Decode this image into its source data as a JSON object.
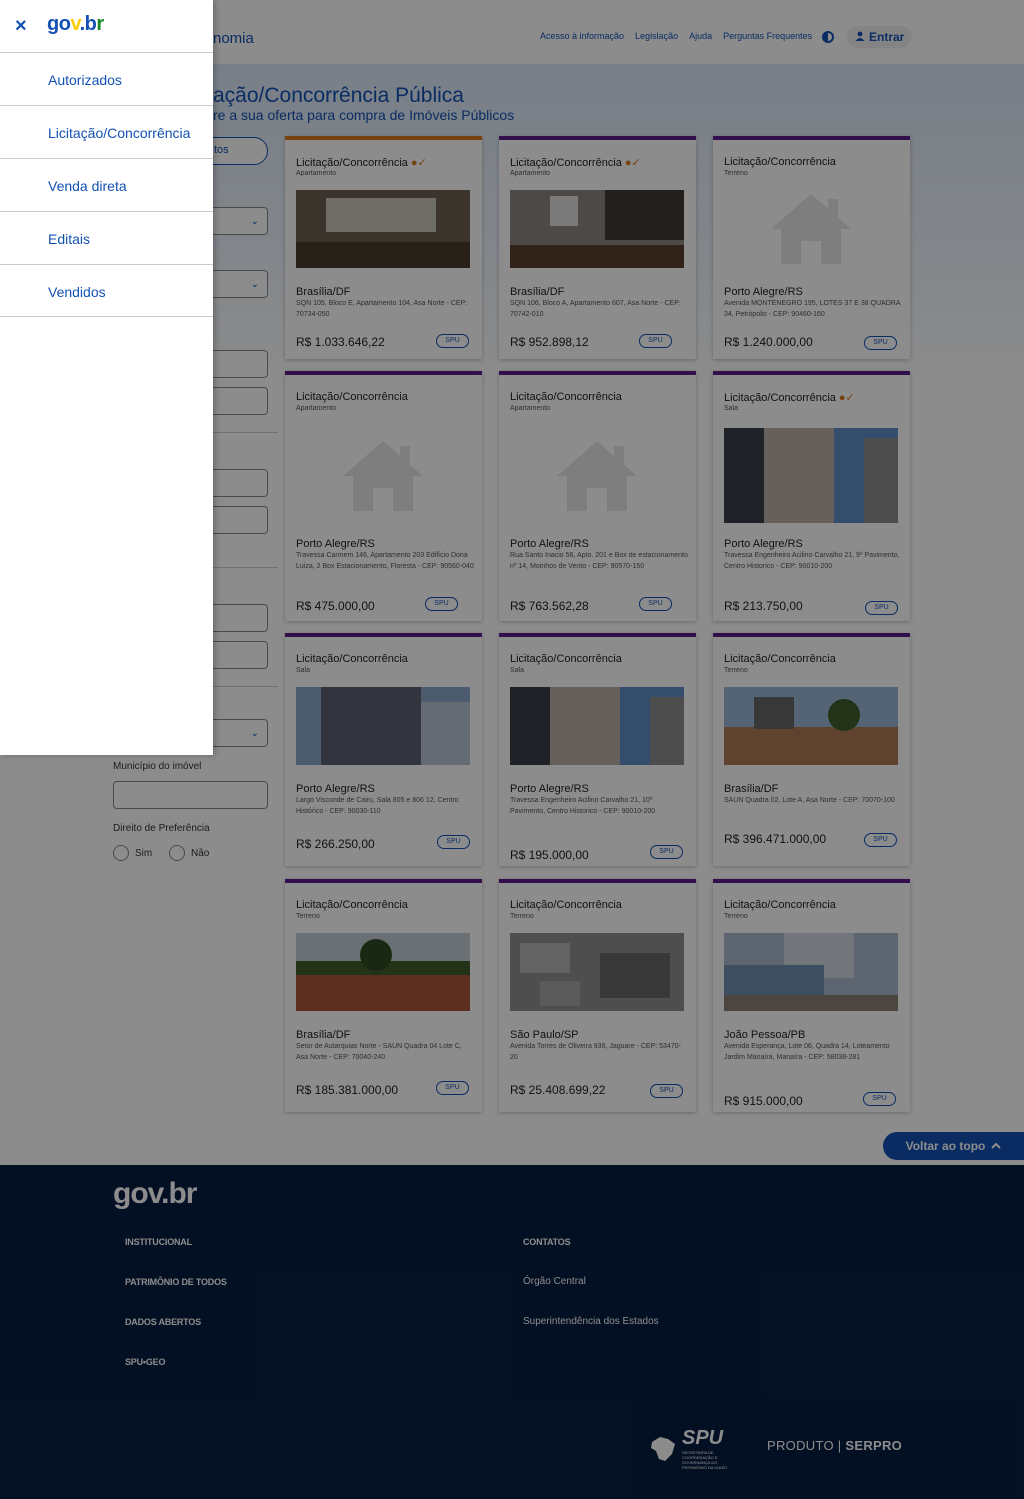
{
  "header": {
    "app_title": "nomia",
    "links": [
      "Acesso à informação",
      "Legislação",
      "Ajuda",
      "Perguntas Frequentes"
    ],
    "login_label": "Entrar"
  },
  "page": {
    "title": "ação/Concorrência Pública",
    "subtitle": "re a sua oferta para compra de Imóveis Públicos",
    "filter_button": "tos"
  },
  "filters": {
    "municipio_label": "Município do imóvel",
    "preferencia_label": "Direito de Preferência",
    "opt_sim": "Sim",
    "opt_nao": "Não"
  },
  "cards": [
    {
      "title": "Licitação/Concorrência",
      "type": "Apartamento",
      "city": "Brasília/DF",
      "address": "SQN 105, Bloco E, Apartamento 104, Asa Norte - CEP: 70734-050",
      "price": "R$ 1.033.646,22",
      "badge": "SPU",
      "authorized": true,
      "image": "room"
    },
    {
      "title": "Licitação/Concorrência",
      "type": "Apartamento",
      "city": "Brasília/DF",
      "address": "SQN 106, Bloco A, Apartamento 607, Asa Norte - CEP: 70742-010",
      "price": "R$ 952.898,12",
      "badge": "SPU",
      "authorized": true,
      "image": "room2"
    },
    {
      "title": "Licitação/Concorrência",
      "type": "Terreno",
      "city": "Porto Alegre/RS",
      "address": "Avenida MONTENEGRO 195, LOTES 37 E 38 QUADRA 34, Petrópolis - CEP: 90460-160",
      "price": "R$ 1.240.000,00",
      "badge": "SPU",
      "authorized": false,
      "image": "placeholder"
    },
    {
      "title": "Licitação/Concorrência",
      "type": "Apartamento",
      "city": "Porto Alegre/RS",
      "address": "Travessa Carmem 146, Apartamento 203 Edifício Dona Luiza, 2 Box Estacionamento, Floresta - CEP: 90560-040",
      "price": "R$ 475.000,00",
      "badge": "SPU",
      "authorized": false,
      "image": "placeholder"
    },
    {
      "title": "Licitação/Concorrência",
      "type": "Apartamento",
      "city": "Porto Alegre/RS",
      "address": "Rua Santo Inacio 56, Apto. 201 e Box de estacionamento nº 14, Moinhos de Vento - CEP: 90570-150",
      "price": "R$ 763.562,28",
      "badge": "SPU",
      "authorized": false,
      "image": "placeholder"
    },
    {
      "title": "Licitação/Concorrência",
      "type": "Sala",
      "city": "Porto Alegre/RS",
      "address": "Travessa Engenheiro Acilino Carvalho 21, 9º Pavimento, Centro Historico - CEP: 90010-200",
      "price": "R$ 213.750,00",
      "badge": "SPU",
      "authorized": true,
      "image": "building"
    },
    {
      "title": "Licitação/Concorrência",
      "type": "Sala",
      "city": "Porto Alegre/RS",
      "address": "Largo Visconde de Cairu, Sala 805 e 806 12, Centro Histórico - CEP: 90030-110",
      "price": "R$ 266.250,00",
      "badge": "SPU",
      "authorized": false,
      "image": "tower"
    },
    {
      "title": "Licitação/Concorrência",
      "type": "Sala",
      "city": "Porto Alegre/RS",
      "address": "Travessa Engenheiro Acilino Carvalho 21, 10º Pavimento, Centro Historico - CEP: 90010-200",
      "price": "R$ 195.000,00",
      "badge": "SPU",
      "authorized": false,
      "image": "building"
    },
    {
      "title": "Licitação/Concorrência",
      "type": "Terreno",
      "city": "Brasília/DF",
      "address": "SAUN Quadra 02, Lote A, Asa Norte - CEP: 70070-100",
      "price": "R$ 396.471.000,00",
      "badge": "SPU",
      "authorized": false,
      "image": "lot"
    },
    {
      "title": "Licitação/Concorrência",
      "type": "Terreno",
      "city": "Brasília/DF",
      "address": "Setor de Autarquias Norte - SAUN Quadra 04 Lote C, Asa Norte - CEP: 70040-240",
      "price": "R$ 185.381.000,00",
      "badge": "SPU",
      "authorized": false,
      "image": "field"
    },
    {
      "title": "Licitação/Concorrência",
      "type": "Terreno",
      "city": "São Paulo/SP",
      "address": "Avenida Torres de Oliveira 936, Jaguare - CEP: 53470-20",
      "price": "R$ 25.408.699,22",
      "badge": "SPU",
      "authorized": false,
      "image": "aerial"
    },
    {
      "title": "Licitação/Concorrência",
      "type": "Terreno",
      "city": "João Pessoa/PB",
      "address": "Avenida Esperança, Lote 06, Quadra 14, Loteamento Jardim Manaíra, Manaíra - CEP: 58038-281",
      "price": "R$ 915.000,00",
      "badge": "SPU",
      "authorized": false,
      "image": "street"
    }
  ],
  "back_to_top": "Voltar ao topo",
  "footer": {
    "logo": "gov.br",
    "links_left": [
      "INSTITUCIONAL",
      "PATRIMÔNIO DE TODOS",
      "DADOS ABERTOS",
      "SPU•GEO"
    ],
    "contacts_heading": "CONTATOS",
    "links_right": [
      "Órgão Central",
      "Superintendência dos Estados"
    ],
    "spu_name": "SPU",
    "spu_sub": "SECRETARIA DE COORDENAÇÃO E GOVERNANÇA DO PATRIMÔNIO DA UNIÃO",
    "produto": "PRODUTO",
    "serpro": "SERPRO"
  },
  "side_menu": {
    "close_label": "×",
    "logo": {
      "a": "go",
      "b": "v",
      "c": ".b",
      "d": "r"
    },
    "items": [
      "Autorizados",
      "Licitação/Concorrência",
      "Venda direta",
      "Editais",
      "Vendidos"
    ]
  }
}
